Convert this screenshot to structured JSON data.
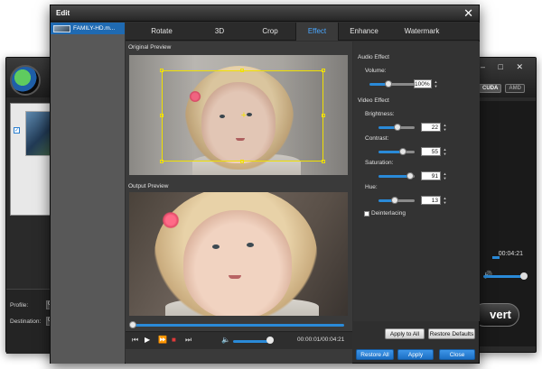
{
  "background_app": {
    "profile_label": "Profile:",
    "profile_value": "C",
    "destination_label": "Destination:",
    "destination_value": "C",
    "gpu_cuda": "CUDA",
    "gpu_amd": "AMD",
    "time": "00:04:21",
    "convert_label": "vert"
  },
  "dialog": {
    "title": "Edit",
    "close_symbol": "✕"
  },
  "file_list": {
    "items": [
      {
        "name": "FAMILY-HD.m..."
      }
    ]
  },
  "tabs": [
    {
      "label": "Rotate",
      "active": false
    },
    {
      "label": "3D",
      "active": false
    },
    {
      "label": "Crop",
      "active": false
    },
    {
      "label": "Effect",
      "active": true
    },
    {
      "label": "Enhance",
      "active": false
    },
    {
      "label": "Watermark",
      "active": false
    }
  ],
  "preview": {
    "original_label": "Original Preview",
    "output_label": "Output Preview"
  },
  "player": {
    "time": "00:00:01/00:04:21",
    "seek_fraction": 0.0,
    "volume_fraction": 0.9
  },
  "effects": {
    "audio_header": "Audio Effect",
    "volume_label": "Volume:",
    "volume_value": "100%",
    "video_header": "Video Effect",
    "brightness_label": "Brightness:",
    "brightness_value": "22",
    "contrast_label": "Contrast:",
    "contrast_value": "55",
    "saturation_label": "Saturation:",
    "saturation_value": "91",
    "hue_label": "Hue:",
    "hue_value": "13",
    "deinterlacing_label": "Deinterlacing"
  },
  "buttons": {
    "apply_to_all": "Apply to All",
    "restore_defaults": "Restore Defaults",
    "restore_all": "Restore All",
    "apply": "Apply",
    "close": "Close"
  },
  "colors": {
    "accent_blue": "#2a8ad8",
    "crop_frame": "#f0e000",
    "active_tab_text": "#4aa7ff",
    "stop_red": "#e03a3a"
  }
}
